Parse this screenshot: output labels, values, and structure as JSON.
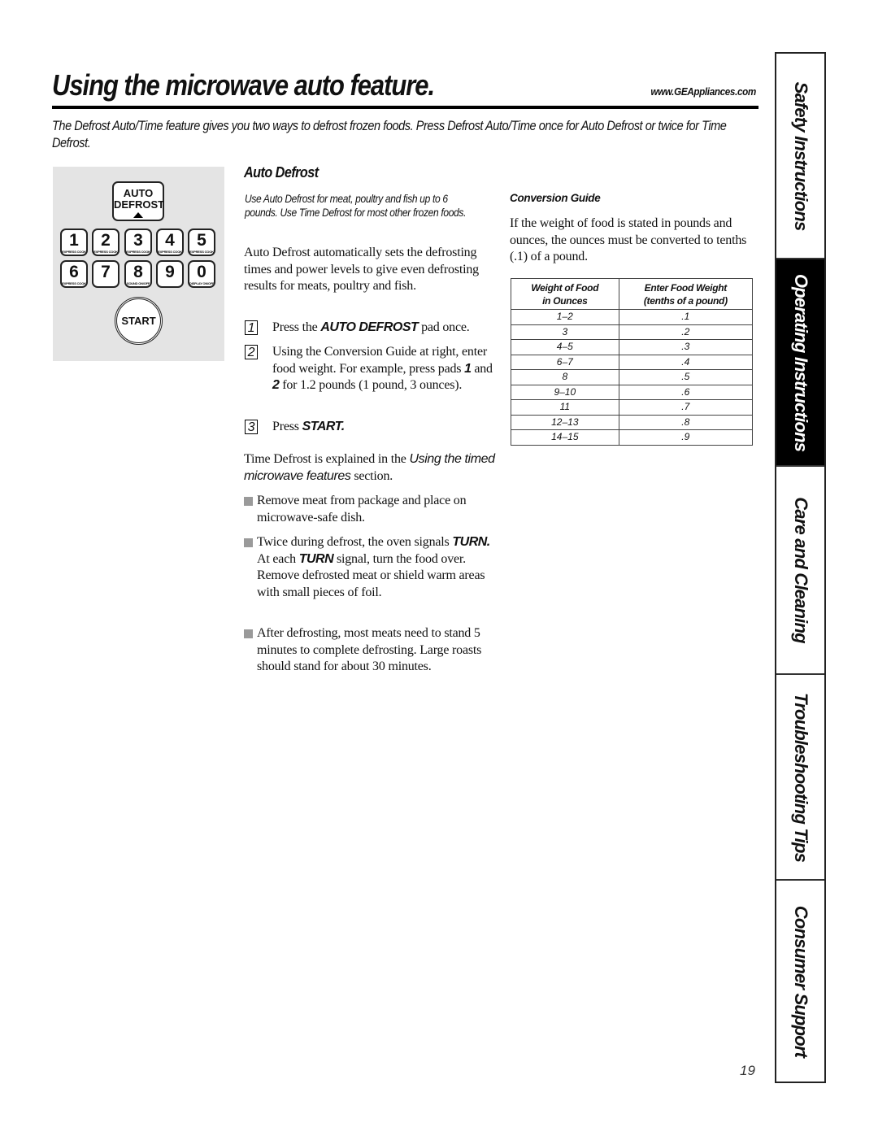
{
  "header": {
    "title": "Using the microwave auto feature.",
    "url": "www.GEAppliances.com"
  },
  "intro": "The Defrost Auto/Time feature gives you two ways to defrost frozen foods. Press Defrost Auto/Time once for Auto Defrost or twice for Time Defrost.",
  "keypad": {
    "auto_defrost": [
      "AUTO",
      "DEFROST"
    ],
    "keys": [
      {
        "digit": "1",
        "sub": "EXPRESS COOK"
      },
      {
        "digit": "2",
        "sub": "EXPRESS COOK"
      },
      {
        "digit": "3",
        "sub": "EXPRESS COOK"
      },
      {
        "digit": "4",
        "sub": "EXPRESS COOK"
      },
      {
        "digit": "5",
        "sub": "EXPRESS COOK"
      },
      {
        "digit": "6",
        "sub": "EXPRESS COOK"
      },
      {
        "digit": "7",
        "sub": ""
      },
      {
        "digit": "8",
        "sub": "SOUND ON/OFF"
      },
      {
        "digit": "9",
        "sub": ""
      },
      {
        "digit": "0",
        "sub": "DISPLAY ON/OFF"
      }
    ],
    "start": "START"
  },
  "auto_defrost": {
    "heading": "Auto Defrost",
    "note": "Use Auto Defrost for meat, poultry and fish up to 6 pounds. Use Time Defrost for most other frozen foods.",
    "body": "Auto Defrost  automatically sets the defrosting times and power levels to give even defrosting results for meats, poultry and fish.",
    "steps": [
      {
        "num": "1",
        "pre": "Press the ",
        "bold": "AUTO DEFROST",
        "post": " pad once."
      },
      {
        "num": "2",
        "pre": "Using the Conversion Guide at right, enter food weight. For example, press pads ",
        "bold1": "1",
        "mid": " and ",
        "bold2": "2",
        "post": " for 1.2 pounds (1 pound, 3 ounces)."
      },
      {
        "num": "3",
        "pre": "Press ",
        "bold": "START."
      }
    ],
    "time_defrost": {
      "pre": "Time Defrost is explained in the ",
      "italic": "Using the timed microwave features",
      "post": " section."
    },
    "bullets": [
      {
        "text": "Remove meat from package and place on microwave-safe dish."
      },
      {
        "pre": "Twice during defrost, the oven signals ",
        "bold1": "TURN.",
        "mid": " At each ",
        "bold2": "TURN",
        "post": " signal, turn the food over. Remove defrosted meat or shield warm areas with small pieces of foil."
      },
      {
        "text": "After defrosting, most meats need to stand 5 minutes to complete defrosting. Large roasts should stand for about 30 minutes."
      }
    ]
  },
  "conversion": {
    "heading": "Conversion Guide",
    "body": "If the weight of food is stated in pounds and ounces, the ounces must be converted to tenths (.1) of a pound.",
    "columns": [
      [
        "Weight of Food",
        "in Ounces"
      ],
      [
        "Enter Food Weight",
        "(tenths of a pound)"
      ]
    ],
    "rows": [
      [
        "1–2",
        ".1"
      ],
      [
        "3",
        ".2"
      ],
      [
        "4–5",
        ".3"
      ],
      [
        "6–7",
        ".4"
      ],
      [
        "8",
        ".5"
      ],
      [
        "9–10",
        ".6"
      ],
      [
        "11",
        ".7"
      ],
      [
        "12–13",
        ".8"
      ],
      [
        "14–15",
        ".9"
      ]
    ]
  },
  "side_tabs": [
    {
      "label": "Safety Instructions",
      "active": false
    },
    {
      "label": "Operating Instructions",
      "active": true
    },
    {
      "label": "Care and Cleaning",
      "active": false
    },
    {
      "label": "Troubleshooting Tips",
      "active": false
    },
    {
      "label": "Consumer Support",
      "active": false
    }
  ],
  "page_number": "19"
}
